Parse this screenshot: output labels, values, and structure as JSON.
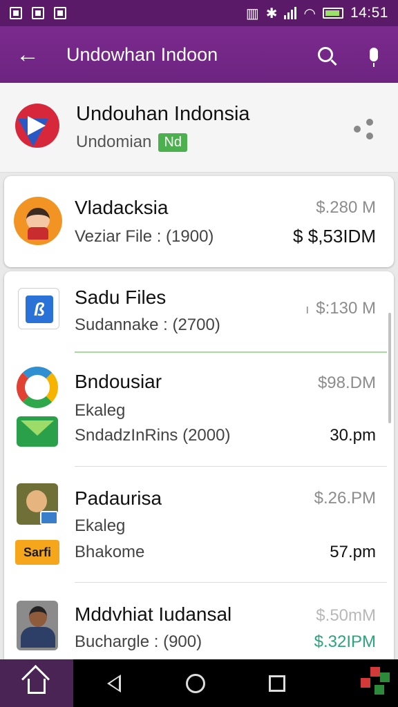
{
  "status_bar": {
    "time": "14:51"
  },
  "app_bar": {
    "title": "Undowhan Indoon"
  },
  "header": {
    "title": "Undouhan Indonsia",
    "subtitle": "Undomian",
    "badge": "Nd"
  },
  "featured": {
    "title": "Vladacksia",
    "subtitle": "Veziar File : (1900)",
    "price": "$.280 M",
    "amount": "$ $,53IDM"
  },
  "list": [
    {
      "title": "Sadu Files",
      "subtitle": "Sudannake : (2700)",
      "price": "$:130 M",
      "price_prefix": "ı"
    },
    {
      "title": "Bndousiar",
      "line2": "Ekaleg",
      "line3": "SndadzInRins (2000)",
      "price": "$98.DM",
      "amount": "30.pm"
    },
    {
      "title": "Padaurisa",
      "line2": "Ekaleg",
      "line3": "Bhakome",
      "price": "$.26.PM",
      "amount": "57.pm",
      "tag": "Sarfi"
    },
    {
      "title": "Mddvhiat Iudansal",
      "subtitle": "Buchargle : (900)",
      "price": "$.50mM",
      "amount": "$.32IPM"
    }
  ],
  "icons": {
    "back": "back-arrow-icon",
    "search": "search-icon",
    "mic": "mic-icon",
    "share": "share-icon",
    "nav_home": "home-icon",
    "nav_back": "triangle-back-icon",
    "nav_home_circle": "circle-home-icon",
    "nav_recents": "square-recents-icon"
  },
  "colors": {
    "accent": "#7b2a8e",
    "badge_green": "#4bb04d",
    "amount_teal": "#2aa57a"
  }
}
